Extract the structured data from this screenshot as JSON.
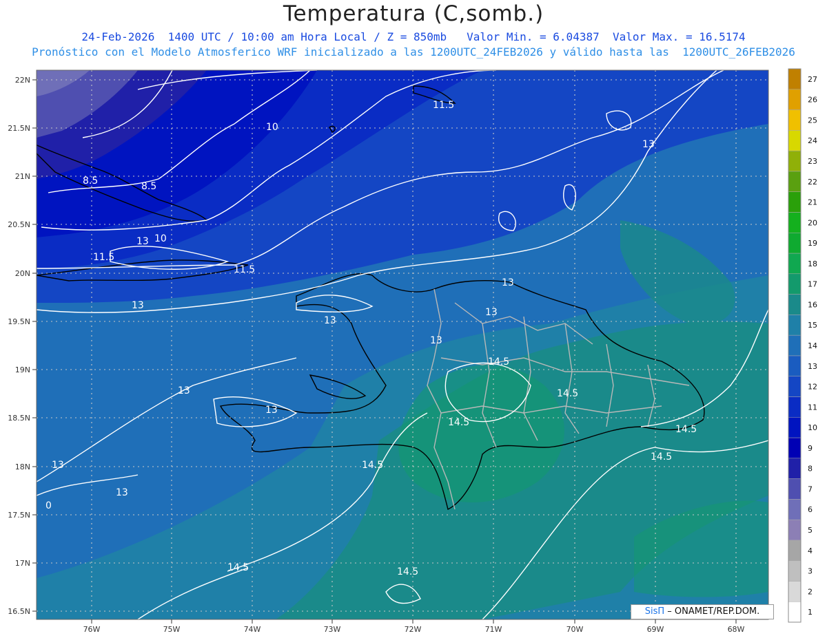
{
  "header": {
    "title": "Temperatura (C,somb.)",
    "line1": "24-Feb-2026  1400 UTC / 10:00 am Hora Local / Z = 850mb   Valor Min. = 6.04387  Valor Max. = 16.5174",
    "line2": "Pronóstico con el Modelo Atmosferico WRF inicializado a las 1200UTC_24FEB2026 y válido hasta las  1200UTC_26FEB2026"
  },
  "credit": {
    "logo": "SisΠ",
    "text": "– ONAMET/REP.DOM."
  },
  "map": {
    "lat_labels": [
      "22N",
      "21.5N",
      "21N",
      "20.5N",
      "20N",
      "19.5N",
      "19N",
      "18.5N",
      "18N",
      "17.5N",
      "17N",
      "16.5N"
    ],
    "lon_labels": [
      "76W",
      "75W",
      "74W",
      "73W",
      "72W",
      "71W",
      "70W",
      "69W",
      "68W"
    ],
    "contour_labels": [
      "11.5",
      "10",
      "13",
      "8.5",
      "8.5",
      "13",
      "10",
      "11.5",
      "11.5",
      "13",
      "13",
      "13",
      "13",
      "13",
      "13",
      "14.5",
      "14.5",
      "14.5",
      "13",
      "13",
      "13",
      "14.5",
      "14.5",
      "14.5",
      "14.5",
      "14.5",
      "0"
    ]
  },
  "colorbar": {
    "levels": [
      "1",
      "2",
      "3",
      "4",
      "5",
      "6",
      "7",
      "8",
      "9",
      "10",
      "11",
      "12",
      "13",
      "14",
      "15",
      "16",
      "17",
      "18",
      "19",
      "20",
      "21",
      "22",
      "23",
      "24",
      "25",
      "26",
      "27"
    ],
    "colors": [
      "#ffffff",
      "#d9d9d9",
      "#bfbfbf",
      "#a6a6a6",
      "#8c7fb5",
      "#6f6fb8",
      "#4f4fb0",
      "#2020a8",
      "#0000b4",
      "#0014c0",
      "#0a2cc4",
      "#1446c4",
      "#1a5cc0",
      "#1f6fb8",
      "#1f80a8",
      "#1a8a8a",
      "#139a6c",
      "#10a850",
      "#0faa30",
      "#14b01e",
      "#2aa00a",
      "#5aa010",
      "#90b008",
      "#d8d800",
      "#f0c000",
      "#e0a000",
      "#c08000"
    ]
  }
}
